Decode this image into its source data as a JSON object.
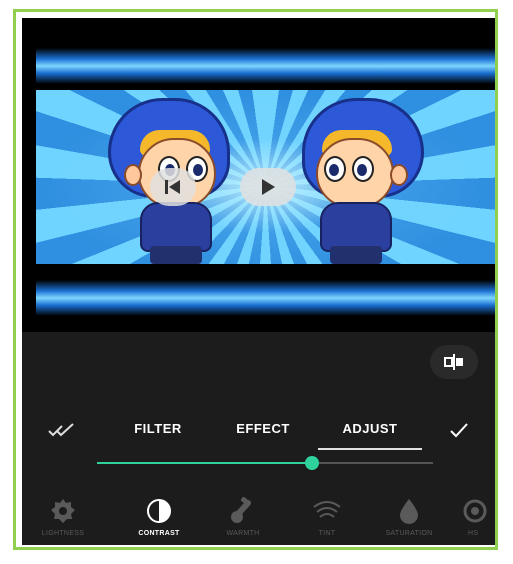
{
  "tabs": {
    "filter": "FILTER",
    "effect": "EFFECT",
    "adjust": "ADJUST",
    "active": "adjust"
  },
  "slider": {
    "value_fraction": 0.64
  },
  "tools": [
    {
      "label": "LIGHTNESS",
      "icon": "gear-icon",
      "active": false
    },
    {
      "label": "CONTRAST",
      "icon": "contrast-icon",
      "active": true
    },
    {
      "label": "WARMTH",
      "icon": "thermometer-icon",
      "active": false
    },
    {
      "label": "TINT",
      "icon": "wifi-waves-icon",
      "active": false
    },
    {
      "label": "SATURATION",
      "icon": "droplet-icon",
      "active": false
    },
    {
      "label": "HS",
      "icon": "hsl-icon",
      "active": false
    }
  ],
  "colors": {
    "accent": "#2fd29c",
    "border": "#8fd14f",
    "panel": "#1c1c1c"
  }
}
